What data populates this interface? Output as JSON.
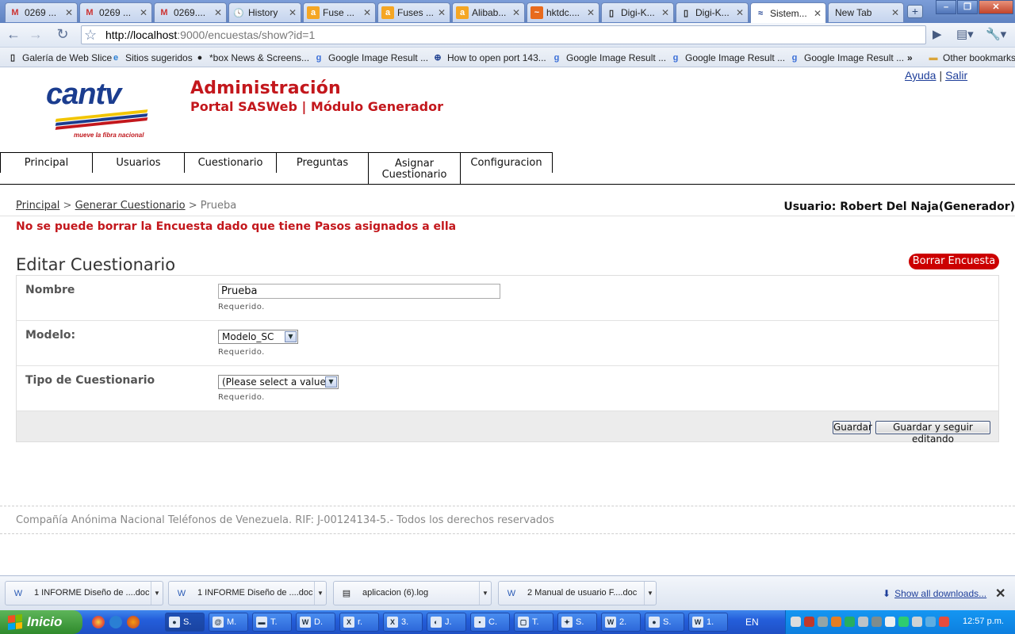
{
  "browser": {
    "tabs": [
      {
        "title": "0269 ...",
        "icon": "gmail-icon"
      },
      {
        "title": "0269 ...",
        "icon": "gmail-icon"
      },
      {
        "title": "0269....",
        "icon": "gmail-icon"
      },
      {
        "title": "History",
        "icon": "history-icon"
      },
      {
        "title": "Fuse ...",
        "icon": "alibaba-icon"
      },
      {
        "title": "Fuses ...",
        "icon": "alibaba-icon"
      },
      {
        "title": "Alibab...",
        "icon": "alibaba-icon"
      },
      {
        "title": "hktdc....",
        "icon": "hktdc-icon"
      },
      {
        "title": "Digi-K...",
        "icon": "page-icon"
      },
      {
        "title": "Digi-K...",
        "icon": "page-icon"
      },
      {
        "title": "Sistem...",
        "icon": "cantv-icon",
        "active": true
      },
      {
        "title": "New Tab",
        "icon": "none"
      }
    ],
    "url_host": "http://localhost",
    "url_rest": ":9000/encuestas/show?id=1",
    "bookmarks": [
      {
        "label": "Galería de Web Slice",
        "icon": "page-icon"
      },
      {
        "label": "Sitios sugeridos",
        "icon": "ie-icon"
      },
      {
        "label": "*box News & Screens...",
        "icon": "xbox-icon"
      },
      {
        "label": "Google Image Result ...",
        "icon": "google-icon"
      },
      {
        "label": "How to open port 143...",
        "icon": "plus-icon"
      },
      {
        "label": "Google Image Result ...",
        "icon": "google-icon"
      },
      {
        "label": "Google Image Result ...",
        "icon": "google-icon"
      },
      {
        "label": "Google Image Result ...",
        "icon": "google-icon"
      }
    ],
    "bookmarks_more": "»",
    "other_bookmarks": "Other bookmarks"
  },
  "header": {
    "logo_text": "cantv",
    "logo_tagline": "mueve la fibra nacional",
    "title": "Administración",
    "subtitle": "Portal SASWeb | Módulo Generador",
    "link_help": "Ayuda",
    "link_separator": "|",
    "link_logout": "Salir"
  },
  "menu": [
    {
      "label": "Principal"
    },
    {
      "label": "Usuarios"
    },
    {
      "label": "Cuestionario"
    },
    {
      "label": "Preguntas"
    },
    {
      "label_line1": "Asignar",
      "label_line2": "Cuestionario"
    },
    {
      "label": "Configuracion"
    }
  ],
  "breadcrumb": {
    "items": [
      "Principal",
      "Generar Cuestionario"
    ],
    "separator": ">",
    "current": "Prueba"
  },
  "user_label": "Usuario: Robert Del Naja(Generador)",
  "error_message": "No se puede borrar la Encuesta dado que tiene Pasos asignados a ella",
  "form": {
    "title": "Editar Cuestionario",
    "delete_button": "Borrar Encuesta",
    "fields": [
      {
        "label": "Nombre",
        "value": "Prueba",
        "help": "Requerido."
      },
      {
        "label": "Modelo:",
        "value": "Modelo_SC",
        "help": "Requerido."
      },
      {
        "label": "Tipo de Cuestionario",
        "value": "(Please select a value)",
        "help": "Requerido."
      }
    ],
    "save_button": "Guardar",
    "save_continue_button": "Guardar y seguir editando"
  },
  "footer": "Compañía Anónima Nacional Teléfonos de Venezuela. RIF: J-00124134-5.- Todos los derechos reservados",
  "downloads": {
    "items": [
      {
        "name": "1 INFORME Diseño de ....doc",
        "icon": "word-doc-icon"
      },
      {
        "name": "1 INFORME Diseño de ....doc",
        "icon": "word-doc-icon"
      },
      {
        "name": "aplicacion (6).log",
        "icon": "log-file-icon"
      },
      {
        "name": "2 Manual de usuario F....doc",
        "icon": "word-doc-icon"
      }
    ],
    "show_all": "Show all downloads...",
    "close": "✕"
  },
  "taskbar": {
    "start_label": "Inicio",
    "tasks": [
      {
        "label": "S.",
        "icon": "chrome-icon",
        "active": true
      },
      {
        "label": "M.",
        "icon": "mail-icon"
      },
      {
        "label": "T.",
        "icon": "folder-icon"
      },
      {
        "label": "D.",
        "icon": "word-icon"
      },
      {
        "label": "r.",
        "icon": "excel-icon"
      },
      {
        "label": "3.",
        "icon": "excel-icon"
      },
      {
        "label": "J.",
        "icon": "eclipse-icon"
      },
      {
        "label": "C.",
        "icon": "cmd-icon"
      },
      {
        "label": "T.",
        "icon": "window-icon"
      },
      {
        "label": "S.",
        "icon": "tool-icon"
      },
      {
        "label": "2.",
        "icon": "word-icon"
      },
      {
        "label": "S.",
        "icon": "firefox-icon"
      },
      {
        "label": "1.",
        "icon": "word-icon"
      }
    ],
    "language": "EN",
    "clock": "12:57 p.m."
  },
  "colors": {
    "brand_red": "#c3171c",
    "brand_blue": "#1b3d8f",
    "delete_button": "#cc0000"
  }
}
